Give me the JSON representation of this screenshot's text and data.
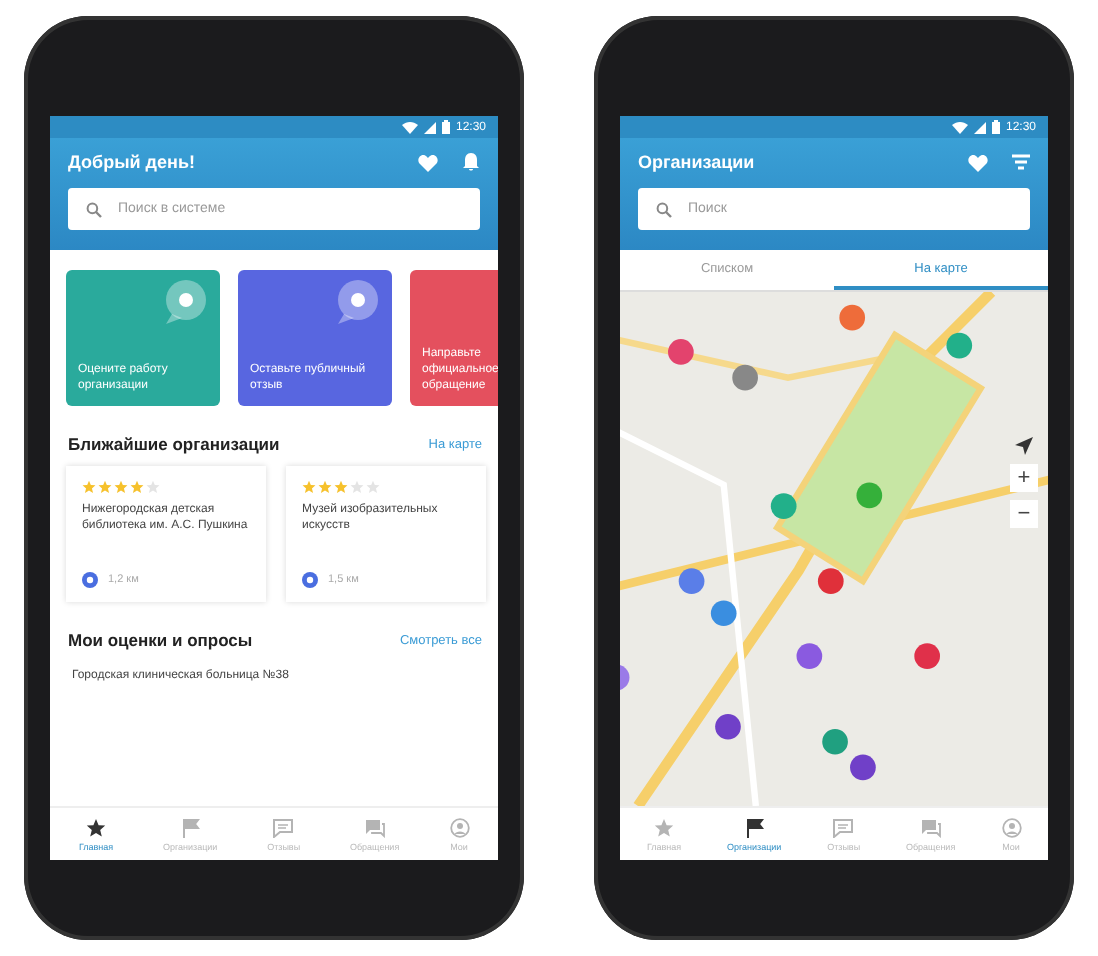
{
  "phones": [
    {
      "kind": "home",
      "status_time": "12:30",
      "title": "Добрый день!",
      "search": {
        "placeholder": "Поиск в системе"
      },
      "action_cards": [
        {
          "text": "Оцените работу организации",
          "color": "#2aaa9c"
        },
        {
          "text": "Оставьте публичный отзыв",
          "color": "#5866e0"
        },
        {
          "text": "Направьте официальное обращение",
          "color": "#e4505e"
        }
      ],
      "nearby_title": "Ближайшие организации",
      "nearby_link": "На карте",
      "nearby": [
        {
          "stars": 4,
          "name": "Нижегородская детская библиотека им. А.С. Пушкина",
          "distance": "1,2 км"
        },
        {
          "stars": 3,
          "name": "Музей изобразительных искусств",
          "distance": "1,5 км"
        }
      ],
      "ratings_title": "Мои оценки и опросы",
      "ratings_link": "Смотреть все",
      "ratings": [
        "Городская клиническая больница №38"
      ],
      "nav": [
        {
          "label": "Главная",
          "selected": true
        },
        {
          "label": "Организации",
          "selected": false
        },
        {
          "label": "Отзывы",
          "selected": false
        },
        {
          "label": "Обращения",
          "selected": false
        },
        {
          "label": "Мои",
          "selected": false
        }
      ]
    },
    {
      "kind": "map",
      "status_time": "12:30",
      "title": "Организации",
      "search": {
        "placeholder": "Поиск"
      },
      "tabs": [
        {
          "label": "Списком",
          "selected": false
        },
        {
          "label": "На карте",
          "selected": true
        }
      ],
      "zoom_in": "+",
      "zoom_out": "−",
      "nav": [
        {
          "label": "Главная",
          "selected": false
        },
        {
          "label": "Организации",
          "selected": true
        },
        {
          "label": "Отзывы",
          "selected": false
        },
        {
          "label": "Обращения",
          "selected": false
        },
        {
          "label": "Мои",
          "selected": false
        }
      ]
    }
  ]
}
